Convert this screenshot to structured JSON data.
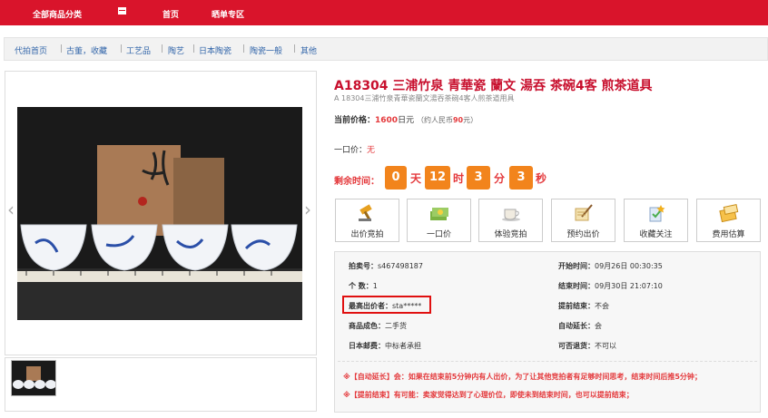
{
  "topnav": {
    "all_categories": "全部商品分类",
    "home": "首页",
    "showcase": "晒单专区"
  },
  "breadcrumb": [
    "代拍首页",
    "古董，收藏",
    "工艺品",
    "陶艺",
    "日本陶瓷",
    "陶瓷一般",
    "其他"
  ],
  "product": {
    "title": "A18304 三浦竹泉 青華瓷 蘭文 湯吞 茶碗4客 煎茶道具",
    "subtitle": "A 18304三浦竹泉青華瓷蘭文湯吞茶碗4客人煎茶道用具",
    "current_price_label": "当前价格：",
    "price_value": "1600",
    "price_unit": "日元",
    "rmb_note_prefix": "（约人民币",
    "rmb_value": "90",
    "rmb_note_suffix": "元）",
    "buyout_label": "一口价：",
    "buyout_value": "无"
  },
  "timer": {
    "label": "剩余时间：",
    "days": "0",
    "days_unit": "天",
    "hours": "12",
    "hours_unit": "时",
    "minutes": "3",
    "minutes_unit": "分",
    "seconds": "3",
    "seconds_unit": "秒"
  },
  "actions": [
    {
      "label": "出价竞拍",
      "icon": "gavel-icon"
    },
    {
      "label": "一口价",
      "icon": "cash-icon"
    },
    {
      "label": "体验竞拍",
      "icon": "coffee-cup-icon"
    },
    {
      "label": "预约出价",
      "icon": "scroll-quill-icon"
    },
    {
      "label": "收藏关注",
      "icon": "bookmark-star-icon"
    },
    {
      "label": "费用估算",
      "icon": "calculator-icon"
    }
  ],
  "info": {
    "auction_id_label": "拍卖号：",
    "auction_id": "s467498187",
    "start_label": "开始时间：",
    "start_time": "09月26日 00:30:35",
    "qty_label": "个 数：",
    "qty": "1",
    "end_label": "结束时间：",
    "end_time": "09月30日 21:07:10",
    "highest_label": "最高出价者：",
    "highest_bidder": "sta*****",
    "early_end_label": "提前结束：",
    "early_end": "不会",
    "condition_label": "商品成色：",
    "condition": "二手货",
    "auto_extend_label": "自动延长：",
    "auto_extend": "会",
    "shipping_label": "日本邮费：",
    "shipping": "中标者承担",
    "returns_label": "可否退货：",
    "returns": "不可以"
  },
  "notes": {
    "auto_extend": "※【自动延长】会：如果在结束前5分钟内有人出价，为了让其他竞拍者有足够时间思考，结束时间后推5分钟；",
    "early_end": "※【提前结束】有可能：卖家觉得达到了心理价位，即使未到结束时间，也可以提前结束；"
  },
  "colors": {
    "brand_red": "#d9142b",
    "timer_orange": "#f2841c",
    "price_red": "#e4393c"
  }
}
